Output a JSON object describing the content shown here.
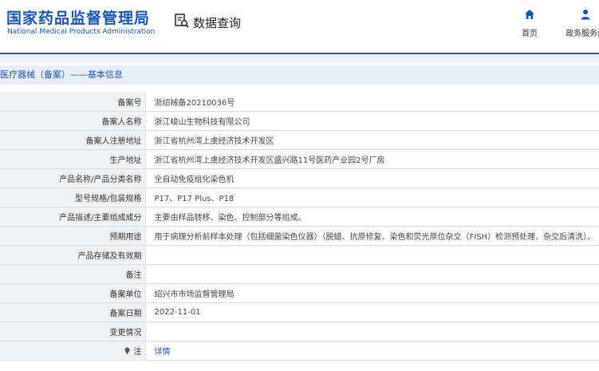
{
  "header": {
    "logo_cn": "国家药品监督管理局",
    "logo_en": "National Medical Products Administration",
    "query_label": "数据查询",
    "nav": [
      {
        "label": "首页",
        "icon": "home-icon"
      },
      {
        "label": "政务服务门",
        "icon": "user-icon"
      }
    ]
  },
  "breadcrumb": "医疗器械（备案）——基本信息",
  "colors": {
    "brand": "#1a56b0",
    "label_bg": "#f0f1f3",
    "border": "#dfe3e8"
  },
  "rows": [
    {
      "key": "备案号",
      "value": "浙绍械备20210036号"
    },
    {
      "key": "备案人名称",
      "value": "浙江峻山生物科技有限公司"
    },
    {
      "key": "备案人注册地址",
      "value": "浙江省杭州湾上虞经济技术开发区"
    },
    {
      "key": "生产地址",
      "value": "浙江省杭州湾上虞经济技术开发区盛兴路11号医药产业园2号厂房"
    },
    {
      "key": "产品名称/产品分类名称",
      "value": "全自动免疫组化染色机"
    },
    {
      "key": "型号规格/包装规格",
      "value": "P17、P17 Plus、P18"
    },
    {
      "key": "产品描述/主要组成成分",
      "value": "主要由样品转移、染色、控制部分等组成。"
    },
    {
      "key": "预期用途",
      "value": "用于病理分析前样本处理（包括细菌染色仪器）（脱蜡、抗原修复、染色和荧光原位杂交（FISH）检测预处理、杂交后清洗）。"
    },
    {
      "key": "产品存储及有效期",
      "value": ""
    },
    {
      "key": "备注",
      "value": ""
    },
    {
      "key": "备案单位",
      "value": "绍兴市市场监督管理局"
    },
    {
      "key": "备案日期",
      "value": "2022-11-01"
    },
    {
      "key": "变更情况",
      "value": ""
    }
  ],
  "note": {
    "key": "注",
    "link": "详情"
  }
}
